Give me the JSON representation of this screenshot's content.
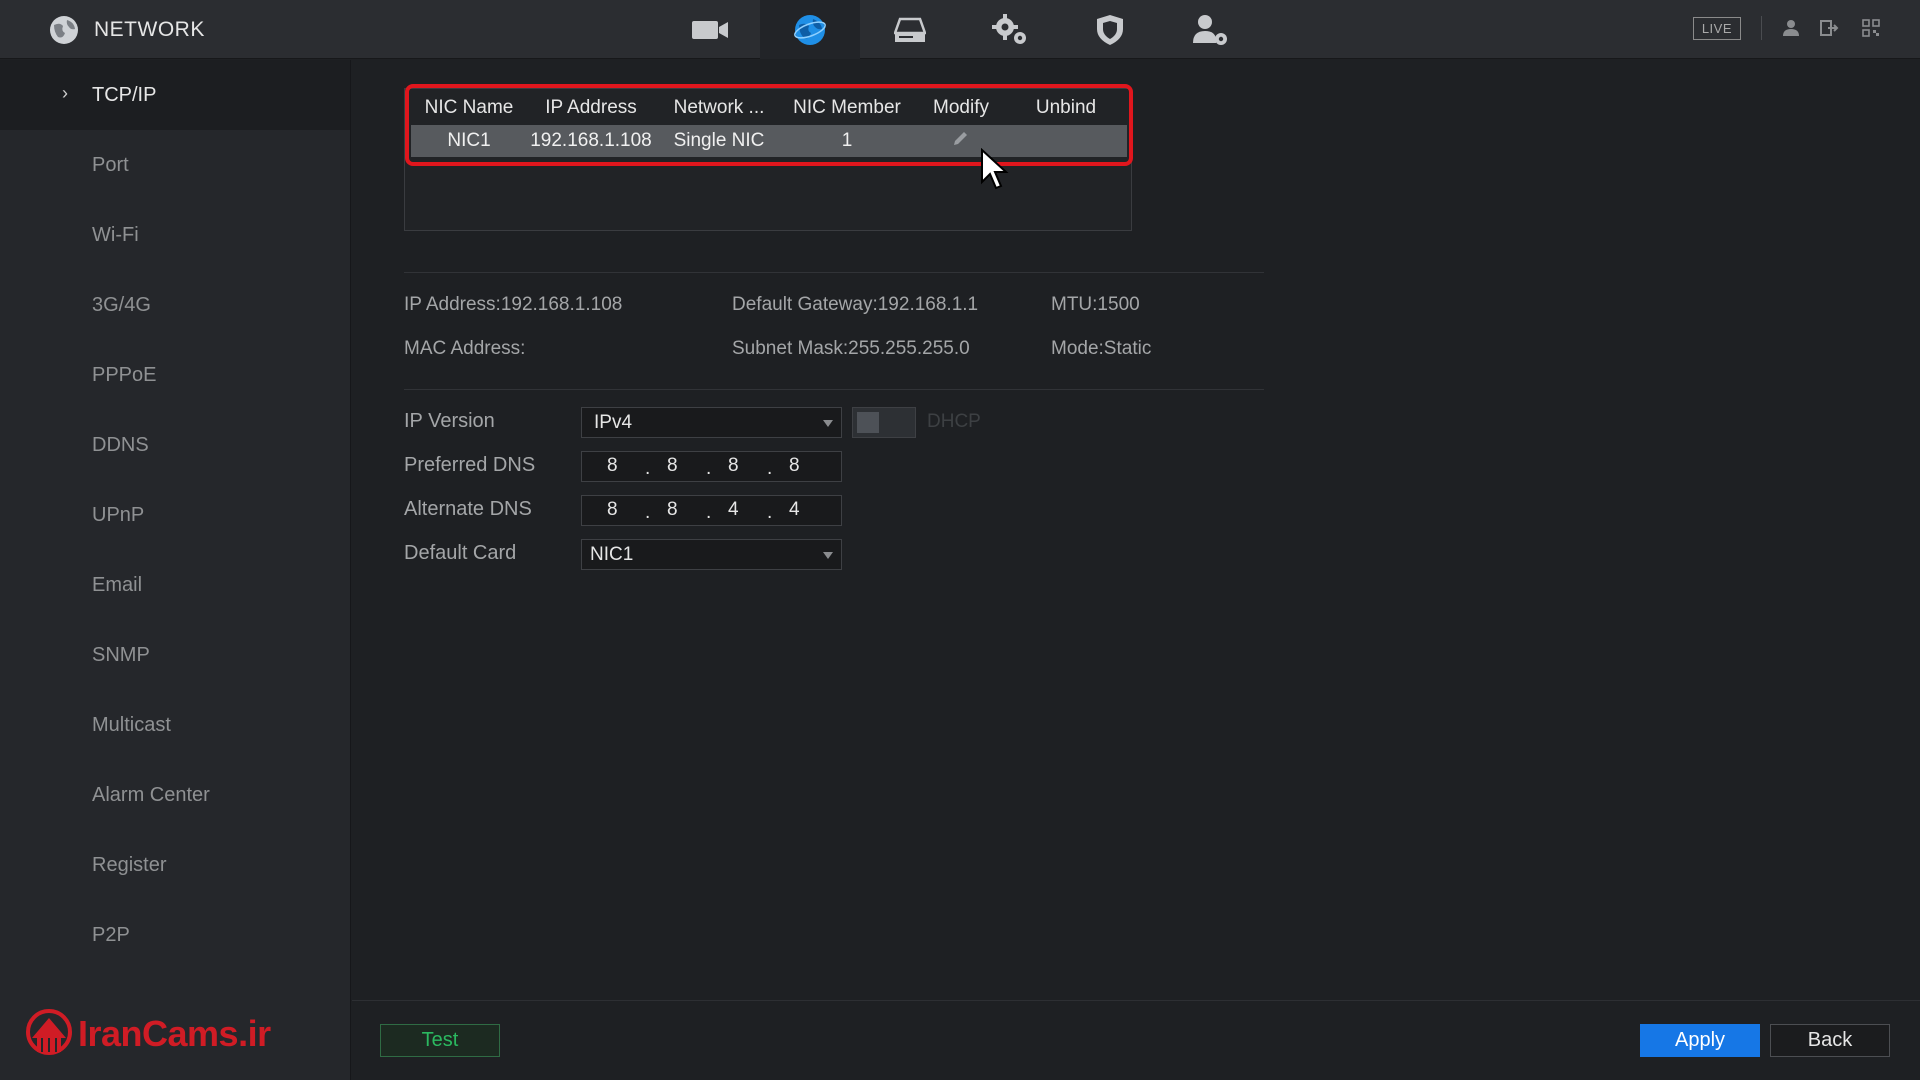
{
  "header": {
    "title": "NETWORK",
    "nav_icons": [
      "camera-icon",
      "network-globe-icon",
      "storage-icon",
      "system-settings-icon",
      "security-shield-icon",
      "account-settings-icon"
    ],
    "active_nav": "network-globe-icon",
    "live_label": "LIVE",
    "right_icons": [
      "user-icon",
      "logout-icon",
      "qr-code-icon"
    ]
  },
  "sidebar": {
    "items": [
      {
        "label": "TCP/IP",
        "active": true
      },
      {
        "label": "Port"
      },
      {
        "label": "Wi-Fi"
      },
      {
        "label": "3G/4G"
      },
      {
        "label": "PPPoE"
      },
      {
        "label": "DDNS"
      },
      {
        "label": "UPnP"
      },
      {
        "label": "Email"
      },
      {
        "label": "SNMP"
      },
      {
        "label": "Multicast"
      },
      {
        "label": "Alarm Center"
      },
      {
        "label": "Register"
      },
      {
        "label": "P2P"
      }
    ],
    "logo_text": "IranCams.ir"
  },
  "nic_table": {
    "headers": [
      "NIC Name",
      "IP Address",
      "Network ...",
      "NIC Member",
      "Modify",
      "Unbind"
    ],
    "rows": [
      {
        "nic_name": "NIC1",
        "ip_address": "192.168.1.108",
        "network": "Single NIC",
        "nic_member": "1",
        "modify_icon": "pencil-edit-icon",
        "unbind": ""
      }
    ]
  },
  "info": {
    "ip_address": "IP Address:192.168.1.108",
    "default_gateway": "Default Gateway:192.168.1.1",
    "mtu": "MTU:1500",
    "mac_address": "MAC Address:",
    "subnet_mask": "Subnet Mask:255.255.255.0",
    "mode": "Mode:Static"
  },
  "form": {
    "ip_version_label": "IP Version",
    "ip_version_value": "IPv4",
    "dhcp_label": "DHCP",
    "dhcp_enabled": false,
    "preferred_dns_label": "Preferred DNS",
    "preferred_dns": [
      "8",
      "8",
      "8",
      "8"
    ],
    "alternate_dns_label": "Alternate DNS",
    "alternate_dns": [
      "8",
      "8",
      "4",
      "4"
    ],
    "default_card_label": "Default Card",
    "default_card_value": "NIC1"
  },
  "buttons": {
    "test": "Test",
    "apply": "Apply",
    "back": "Back"
  },
  "colors": {
    "accent_blue": "#1677e6",
    "test_green": "#2bb860",
    "highlight_red": "#e0161d",
    "logo_red": "#d01c25"
  }
}
